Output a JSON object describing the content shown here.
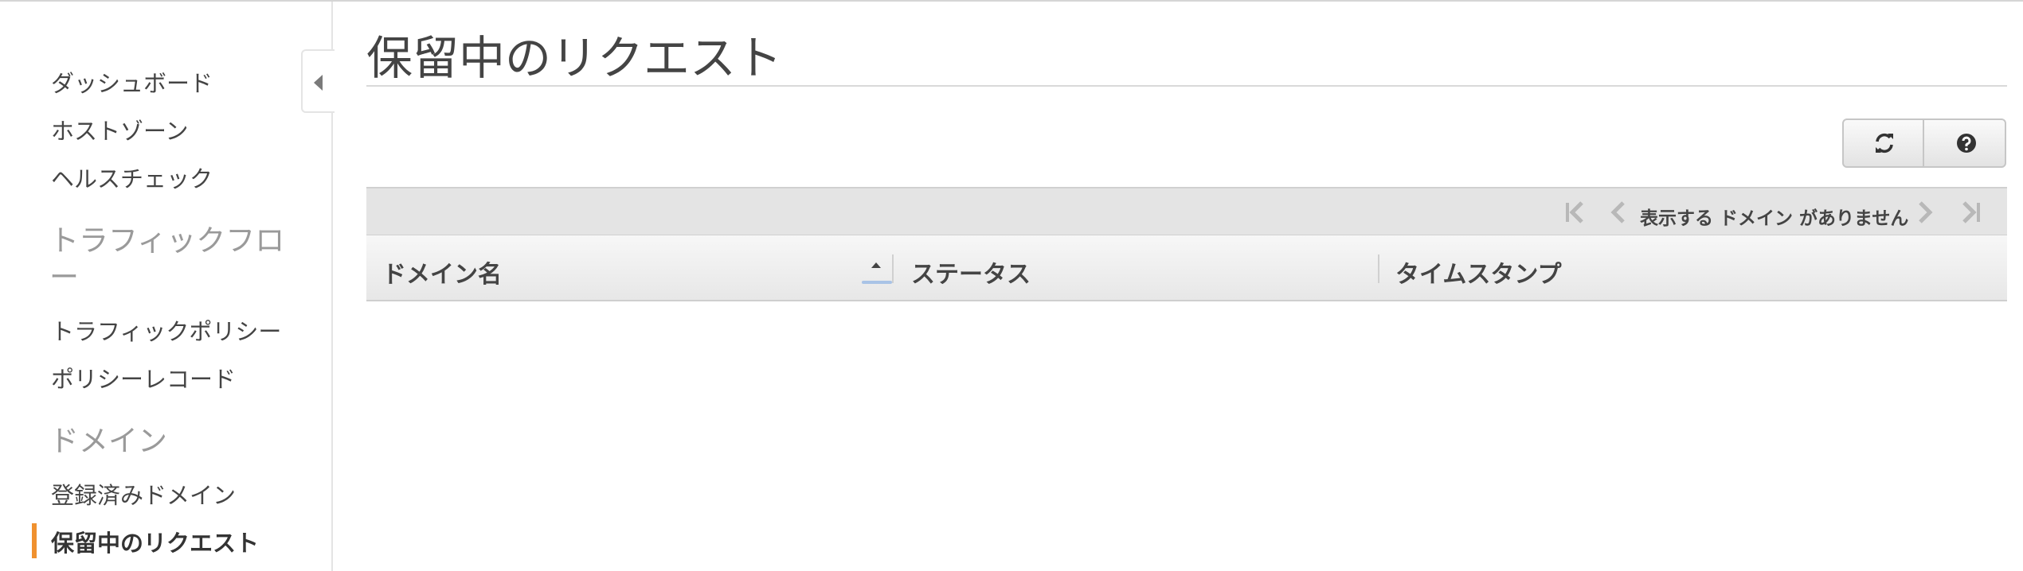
{
  "sidebar": {
    "items": [
      {
        "label": "ダッシュボード"
      },
      {
        "label": "ホストゾーン"
      },
      {
        "label": "ヘルスチェック"
      }
    ],
    "section_traffic_flow": "トラフィックフロー",
    "traffic_items": [
      {
        "label": "トラフィックポリシー"
      },
      {
        "label": "ポリシーレコード"
      }
    ],
    "section_domains": "ドメイン",
    "domain_items": [
      {
        "label": "登録済みドメイン"
      },
      {
        "label": "保留中のリクエスト",
        "active": true
      }
    ],
    "accent_color": "#f0912f"
  },
  "main": {
    "title": "保留中のリクエスト",
    "toolbar": {
      "refresh_icon": "refresh-icon",
      "help_icon": "help-icon"
    },
    "table": {
      "pager_text": "表示する ドメイン がありません",
      "columns": [
        "ドメイン名",
        "ステータス",
        "タイムスタンプ"
      ],
      "sort": {
        "column": "ドメイン名",
        "direction": "ascending"
      },
      "rows": []
    }
  }
}
